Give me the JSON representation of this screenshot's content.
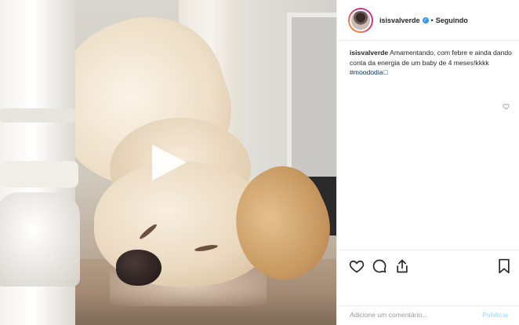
{
  "post": {
    "username": "isisvalverde",
    "separator": "•",
    "follow_label": "Seguindo",
    "caption_username": "isisvalverde",
    "caption_text": "Amamentando, com febre e ainda dando conta da energia de um baby de 4 meses!kkkk",
    "hashtag": "#moododia",
    "hashtag_emoji": "🏻"
  },
  "comment": {
    "placeholder": "Adicione um comentário...",
    "publish_label": "Publicar"
  },
  "icons": {
    "play": "play-icon",
    "verified": "verified-badge-icon",
    "like_small": "heart-outline-icon",
    "like": "heart-icon",
    "comment": "comment-icon",
    "share": "share-icon",
    "save": "bookmark-icon"
  },
  "colors": {
    "verified": "#3897f0",
    "hashtag": "#003569",
    "publish": "#b2dffc"
  }
}
